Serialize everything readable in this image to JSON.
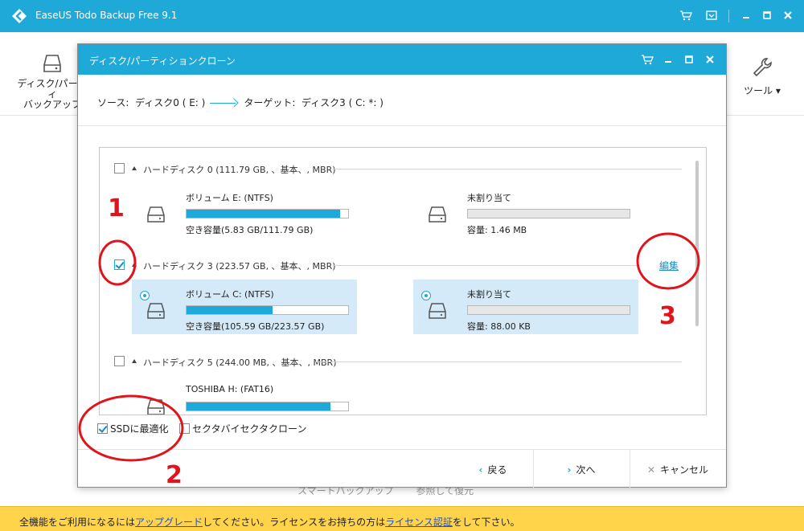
{
  "app": {
    "title": "EaseUS Todo Backup Free 9.1",
    "colors": {
      "accent": "#1fa9d8",
      "selection": "#d4eaf8",
      "notice": "#ffd34a",
      "annotation": "#e0141c"
    }
  },
  "toolbar": {
    "left_tool_line1": "ディスク/パーティ",
    "left_tool_line2": "バックアップ",
    "right_tool_label": "ツール ▾"
  },
  "behind": {
    "bottom_text": "スマートバックアップ　　  参照して復元"
  },
  "notice": {
    "prefix": "全機能をご利用になるには",
    "upgrade_link": "アップグレード",
    "middle": "してください。ライセンスをお持ちの方は",
    "license_link": "ライセンス認証",
    "suffix": "をして下さい。"
  },
  "dialog": {
    "title": "ディスク/パーティションクローン",
    "source_label": "ソース:",
    "source_value": "ディスク0 ( E: )",
    "target_label": "ターゲット:",
    "target_value": "ディスク3 ( C: *: )",
    "disks": [
      {
        "label": "ハードディスク 0 (111.79 GB, 、基本、, MBR)",
        "checked": false,
        "partitions": [
          {
            "name": "ボリューム E: (NTFS)",
            "capacity": "空き容量(5.83 GB/111.79 GB)",
            "used_fraction": 0.95,
            "selected": false
          },
          {
            "name": "未割り当て",
            "capacity": "容量: 1.46 MB",
            "used_fraction": 0,
            "selected": false
          }
        ]
      },
      {
        "label": "ハードディスク 3 (223.57 GB, 、基本、, MBR)",
        "checked": true,
        "edit_link": "編集",
        "partitions": [
          {
            "name": "ボリューム C: (NTFS)",
            "capacity": "空き容量(105.59 GB/223.57 GB)",
            "used_fraction": 0.53,
            "selected": true
          },
          {
            "name": "未割り当て",
            "capacity": "容量: 88.00 KB",
            "used_fraction": 0,
            "selected": true
          }
        ]
      },
      {
        "label": "ハードディスク 5 (244.00 MB, 、基本、, MBR)",
        "checked": false,
        "partitions": [
          {
            "name": "TOSHIBA H: (FAT16)",
            "capacity": "",
            "used_fraction": 0.89,
            "selected": false
          }
        ]
      }
    ],
    "options": {
      "ssd_label": "SSDに最適化",
      "ssd_checked": true,
      "sector_label": "セクタバイセクタクローン",
      "sector_checked": false
    },
    "footer": {
      "back": "戻る",
      "next": "次へ",
      "cancel": "キャンセル"
    }
  },
  "annotations": {
    "n1": "1",
    "n2": "2",
    "n3": "3"
  }
}
